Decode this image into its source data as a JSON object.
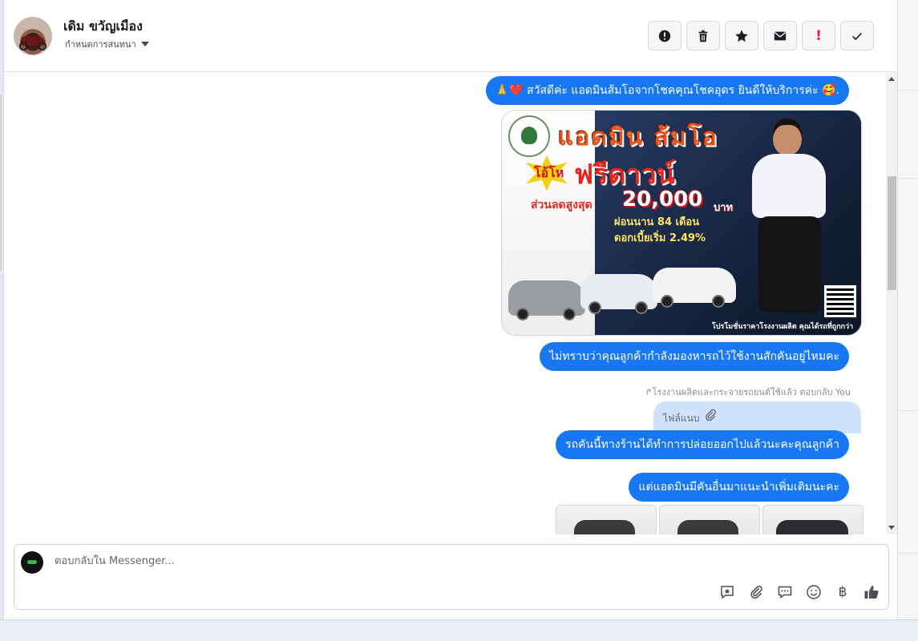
{
  "header": {
    "contact_name": "เดิม ขวัญเมือง",
    "label_assign": "กำหนดการสนทนา",
    "actions": [
      {
        "name": "alert-icon"
      },
      {
        "name": "trash-icon"
      },
      {
        "name": "star-icon"
      },
      {
        "name": "envelope-icon"
      },
      {
        "name": "exclamation-icon"
      },
      {
        "name": "check-icon"
      }
    ]
  },
  "messages": {
    "m1": "🙏❤️ สวัสดีค่ะ แอดมินส้มโอจากโชคคุณโชคอุดร ยินดีให้บริการค่ะ 🥰.",
    "promo": {
      "title": "แอดมิน ส้มโอ",
      "badge": "โอ้โห",
      "headline": "ฟรีดาวน์",
      "discount_label": "ส่วนลดสูงสุด",
      "discount_amount": "20,000",
      "discount_unit": "บาท",
      "line1": "ผ่อนนาน 84 เดือน",
      "line2": "ดอกเบี้ยเริ่ม 2.49%",
      "footer": "โปรโมชั่นราคาโรงงานผลิต คุณได้รถที่ถูกกว่า"
    },
    "m2": "ไม่ทราบว่าคุณลูกค้ากำลังมองหารถไว้ใช้งานสักคันอยู่ไหมคะ",
    "reply_meta": "↱โรงงานผลิตและกระจายรถยนต์ใช้แล้ว ตอบกลับ You",
    "attachment_label": "ไฟล์แนบ",
    "m3": "รถคันนี้ทางร้านได้ทำการปล่อยออกไปแล้วนะคะคุณลูกค้า",
    "m4": "แต่แอดมินมีคันอื่นมาแนะนำเพิ่มเติมนะคะ"
  },
  "composer": {
    "placeholder": "ตอบกลับใน Messenger...",
    "tools": [
      "saved-reply-icon",
      "paperclip-icon",
      "chat-bubble-icon",
      "emoji-icon",
      "baht-icon",
      "thumbs-up-icon"
    ],
    "baht_symbol": "฿"
  },
  "colors": {
    "bubble": "#1877f2",
    "attachment_bg": "#cfe3ff",
    "accent_red": "#e41e3f"
  }
}
